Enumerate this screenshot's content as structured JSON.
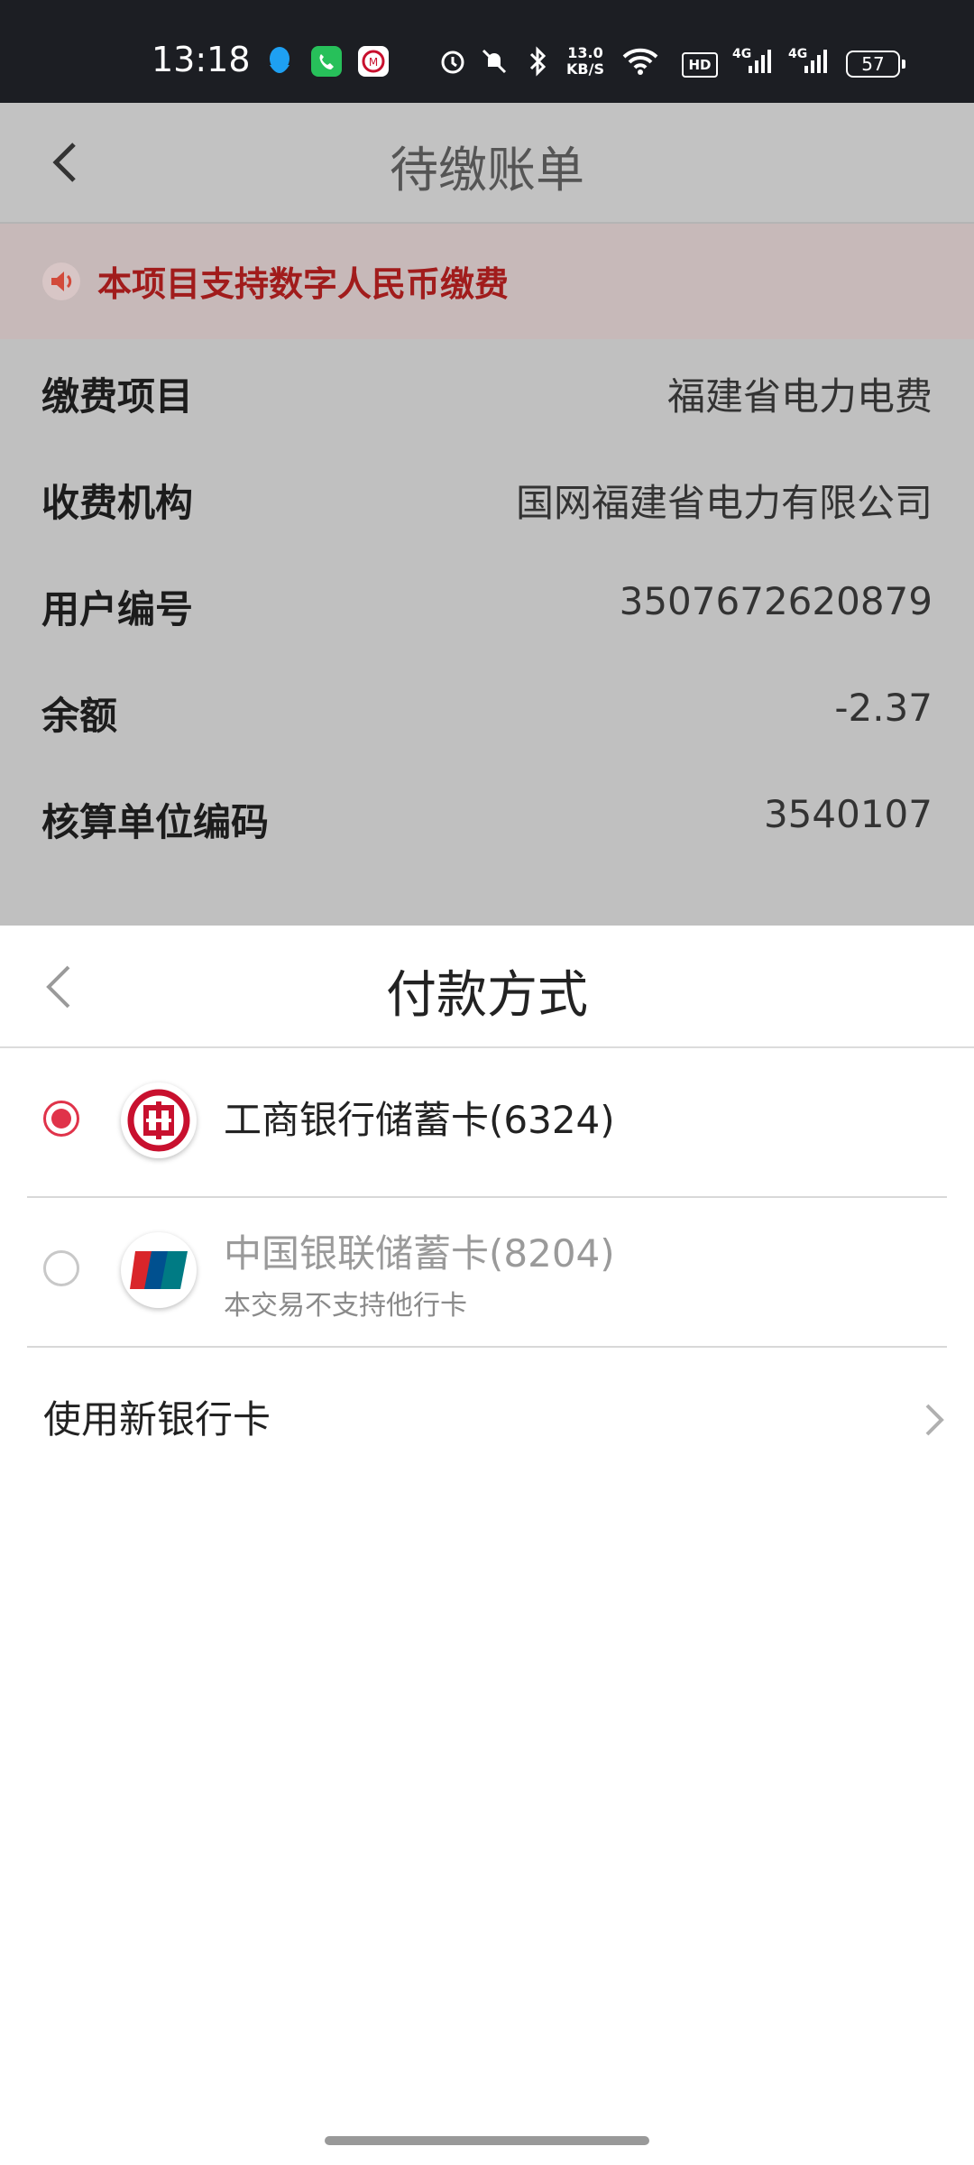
{
  "status_bar": {
    "time": "13:18",
    "net_speed_value": "13.0",
    "net_speed_unit": "KB/S",
    "hd_label": "HD",
    "signal1_label": "4G",
    "signal2_label": "4G",
    "battery": "57",
    "icons": [
      "qq-icon",
      "phone-icon",
      "bank-app-icon",
      "alarm-icon",
      "mute-icon",
      "bluetooth-icon",
      "wifi-icon",
      "signal-icon",
      "battery-icon"
    ]
  },
  "background_page": {
    "title": "待缴账单",
    "notice": "本项目支持数字人民币缴费",
    "rows": [
      {
        "label": "缴费项目",
        "value": "福建省电力电费"
      },
      {
        "label": "收费机构",
        "value": "国网福建省电力有限公司"
      },
      {
        "label": "用户编号",
        "value": "3507672620879"
      },
      {
        "label": "余额",
        "value": "-2.37"
      },
      {
        "label": "核算单位编码",
        "value": "3540107"
      }
    ]
  },
  "sheet": {
    "title": "付款方式",
    "options": [
      {
        "name": "工商银行储蓄卡(6324)",
        "note": "",
        "selected": true,
        "enabled": true,
        "logo": "icbc-logo"
      },
      {
        "name": "中国银联储蓄卡(8204)",
        "note": "本交易不支持他行卡",
        "selected": false,
        "enabled": false,
        "logo": "unionpay-logo"
      }
    ],
    "new_card_label": "使用新银行卡"
  },
  "colors": {
    "accent_red": "#e0334a",
    "notice_red": "#a11c1c",
    "disabled_text": "#9a9a9a"
  }
}
